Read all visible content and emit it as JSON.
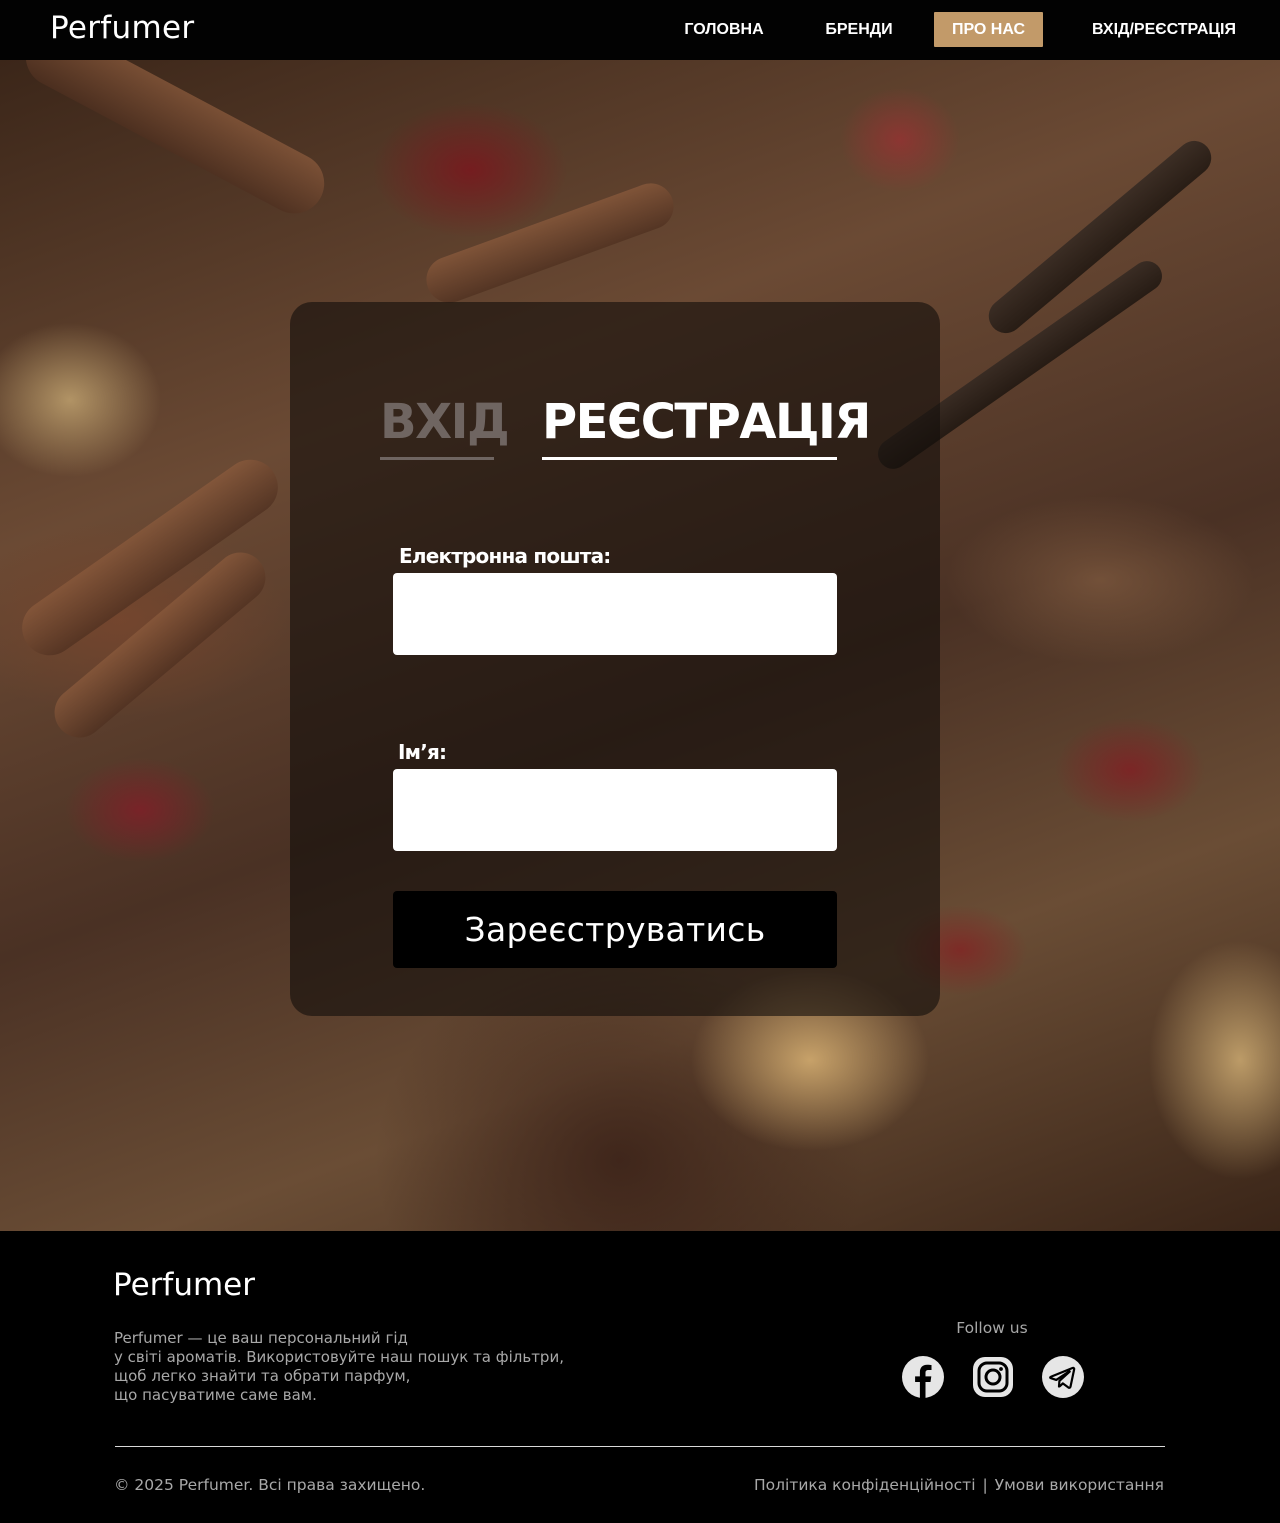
{
  "header": {
    "logo": "Perfumer",
    "nav": {
      "home": "ГОЛОВНА",
      "brands": "БРЕНДИ",
      "about": "ПРО НАС",
      "auth": "ВХІД/РЕЄСТРАЦІЯ"
    },
    "active_accent": "#c29a69"
  },
  "auth_card": {
    "tabs": {
      "login": "ВХІД",
      "register": "РЕЄСТРАЦІЯ",
      "active": "register"
    },
    "email_label": "Електронна пошта:",
    "email_value": "",
    "name_label": "Ім’я:",
    "name_value": "",
    "submit_label": "Зареєструватись"
  },
  "footer": {
    "logo": "Perfumer",
    "description": [
      "Perfumer — це ваш персональний гід",
      "у світі ароматів. Використовуйте наш пошук та фільтри,",
      "щоб легко знайти та обрати парфум,",
      "що пасуватиме саме вам."
    ],
    "follow_label": "Follow us",
    "social_icons": [
      "facebook-icon",
      "instagram-icon",
      "telegram-icon"
    ],
    "copyright": "© 2025 Perfumer. Всі права захищено.",
    "privacy_label": "Політика конфіденційності",
    "separator": "|",
    "terms_label": "Умови використання"
  }
}
